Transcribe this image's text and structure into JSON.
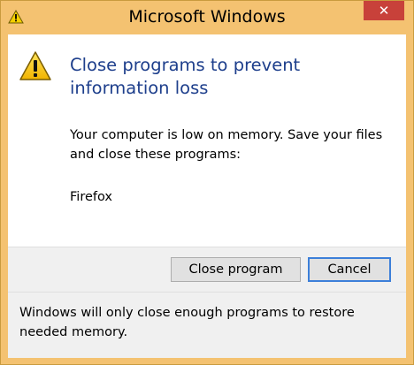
{
  "window": {
    "title": "Microsoft Windows",
    "title_icon": "warning-icon",
    "close_glyph": "✕",
    "colors": {
      "frame": "#f4c271",
      "close_button": "#c8413a",
      "heading": "#1e3f8c"
    }
  },
  "dialog": {
    "icon": "warning-icon",
    "heading": "Close programs to prevent information loss",
    "message": "Your computer is low on memory. Save your files and close these programs:",
    "programs": [
      "Firefox"
    ]
  },
  "buttons": {
    "close_program": "Close program",
    "cancel": "Cancel"
  },
  "footer": {
    "text": "Windows will only close enough programs to restore needed memory."
  }
}
